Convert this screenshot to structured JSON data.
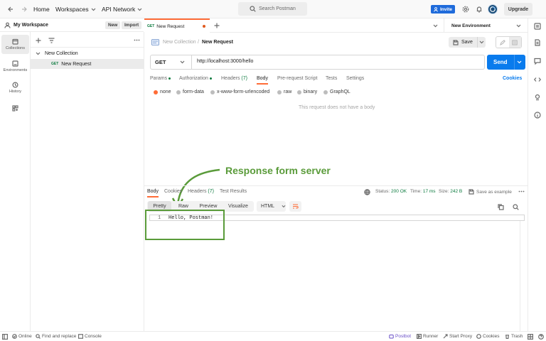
{
  "topbar": {
    "home": "Home",
    "workspaces": "Workspaces",
    "api_network": "API Network",
    "search_placeholder": "Search Postman",
    "invite": "Invite",
    "upgrade": "Upgrade"
  },
  "workspace": {
    "name": "My Workspace",
    "new_label": "New",
    "import_label": "Import"
  },
  "rail": [
    {
      "label": "Collections",
      "icon": "collections-icon"
    },
    {
      "label": "Environments",
      "icon": "environments-icon"
    },
    {
      "label": "History",
      "icon": "history-icon"
    },
    {
      "label": "",
      "icon": "apps-icon"
    }
  ],
  "sidebar": {
    "collection_name": "New Collection",
    "request_method": "GET",
    "request_name": "New Request"
  },
  "tabs": {
    "active_method": "GET",
    "active_name": "New Request",
    "environment": "New Environment"
  },
  "request": {
    "breadcrumb_collection": "New Collection",
    "breadcrumb_separator": "/",
    "title": "New Request",
    "save_label": "Save",
    "method": "GET",
    "url": "http://localhost:3000/hello",
    "send_label": "Send",
    "subtabs": [
      "Params",
      "Authorization",
      "Headers",
      "Body",
      "Pre-request Script",
      "Tests",
      "Settings"
    ],
    "headers_count": "(7)",
    "cookies_label": "Cookies",
    "body_options": [
      "none",
      "form-data",
      "x-www-form-urlencoded",
      "raw",
      "binary",
      "GraphQL"
    ],
    "no_body_text": "This request does not have a body"
  },
  "annotation": {
    "text": "Response form server",
    "color": "#5a9b3a"
  },
  "response": {
    "tabs": [
      "Body",
      "Cookies",
      "Headers",
      "Test Results"
    ],
    "headers_count": "(7)",
    "status_label": "Status:",
    "status_value": "200 OK",
    "time_label": "Time:",
    "time_value": "17 ms",
    "size_label": "Size:",
    "size_value": "242 B",
    "save_example": "Save as example",
    "view_modes": [
      "Pretty",
      "Raw",
      "Preview",
      "Visualize"
    ],
    "format": "HTML",
    "line_number": "1",
    "body_text": "Hello, Postman!"
  },
  "statusbar": {
    "online": "Online",
    "find_replace": "Find and replace",
    "console": "Console",
    "postbot": "Postbot",
    "runner": "Runner",
    "start_proxy": "Start Proxy",
    "cookies": "Cookies",
    "trash": "Trash"
  },
  "colors": {
    "accent": "#097bed",
    "invite": "#1f6bdb",
    "get_method": "#0b7a3e",
    "status_ok": "#0b7a3e",
    "annotation": "#5a9b3a",
    "active_tab_underline": "#ff6c37"
  }
}
